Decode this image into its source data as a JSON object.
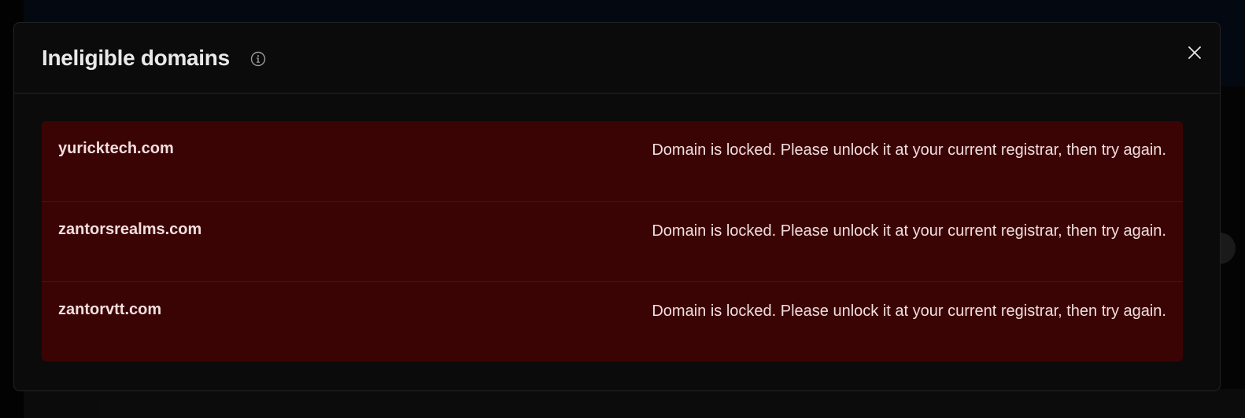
{
  "modal": {
    "title": "Ineligible domains",
    "info_icon": "info-circle-icon",
    "close_icon": "close-icon"
  },
  "domains": [
    {
      "name": "yuricktech.com",
      "reason": "Domain is locked. Please unlock it at your current registrar, then try again."
    },
    {
      "name": "zantorsrealms.com",
      "reason": "Domain is locked. Please unlock it at your current registrar, then try again."
    },
    {
      "name": "zantorvtt.com",
      "reason": "Domain is locked. Please unlock it at your current registrar, then try again."
    }
  ],
  "colors": {
    "modal_bg": "#0b0b0b",
    "error_bg": "#3b0404",
    "error_text": "#f2dede"
  }
}
